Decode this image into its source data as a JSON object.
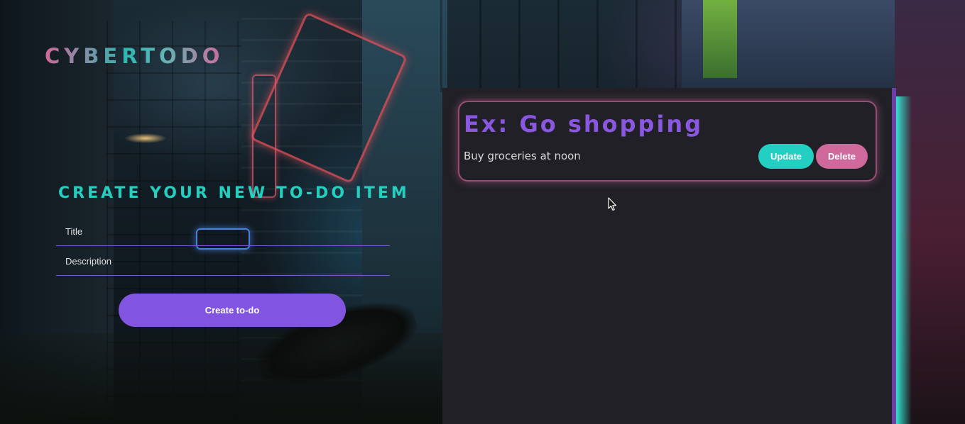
{
  "app": {
    "logo_text": "CYBERTODO"
  },
  "create_form": {
    "heading": "CREATE YOUR NEW TO-DO ITEM",
    "title_placeholder": "Title",
    "title_value": "",
    "description_placeholder": "Description",
    "description_value": "",
    "submit_label": "Create to-do"
  },
  "todos": [
    {
      "title": "Ex: Go shopping",
      "description": "Buy groceries at noon",
      "update_label": "Update",
      "delete_label": "Delete"
    }
  ],
  "colors": {
    "accent_purple": "#8255e0",
    "accent_teal": "#23cfc1",
    "accent_pink": "#d0699b",
    "panel_bg": "#212026"
  },
  "icons": {
    "cursor": "mouse-pointer-icon"
  }
}
